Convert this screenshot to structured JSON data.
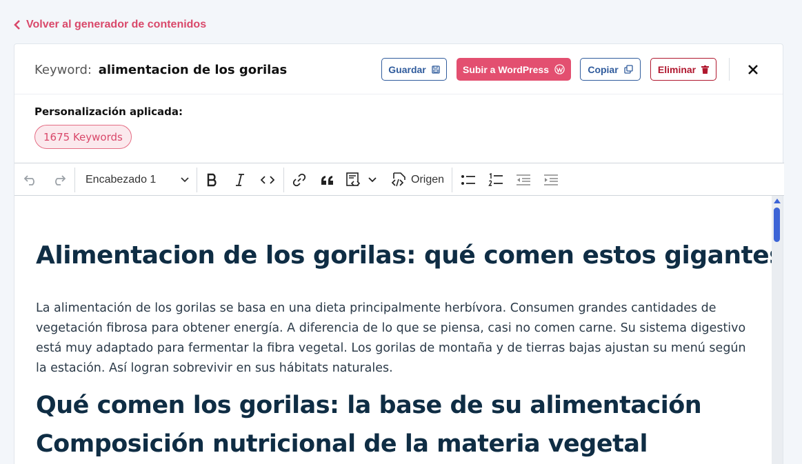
{
  "back_link": "Volver al generador de contenidos",
  "header": {
    "keyword_label": "Keyword:",
    "keyword_value": "alimentacion de los gorilas",
    "buttons": {
      "save": "Guardar",
      "wordpress": "Subir a WordPress",
      "copy": "Copiar",
      "delete": "Eliminar"
    }
  },
  "personalization": {
    "title": "Personalización aplicada:",
    "chip": "1675 Keywords"
  },
  "toolbar": {
    "heading_select": "Encabezado 1",
    "origin_label": "Origen"
  },
  "content": {
    "h1": "Alimentacion de los gorilas: qué comen estos gigantes",
    "paragraph": "La alimentación de los gorilas se basa en una dieta principalmente herbívora. Consumen grandes cantidades de vegetación fibrosa para obtener energía. A diferencia de lo que se piensa, casi no comen carne. Su sistema digestivo está muy adaptado para fermentar la fibra vegetal. Los gorilas de montaña y de tierras bajas ajustan su menú según la estación. Así logran sobrevivir en sus hábitats naturales.",
    "h2_1": "Qué comen los gorilas: la base de su alimentación",
    "h2_2": "Composición nutricional de la materia vegetal"
  },
  "colors": {
    "accent_pink": "#e34f70",
    "primary_blue": "#2f5b9c",
    "danger_red": "#b0172e",
    "scroll_blue": "#3c64d6"
  }
}
